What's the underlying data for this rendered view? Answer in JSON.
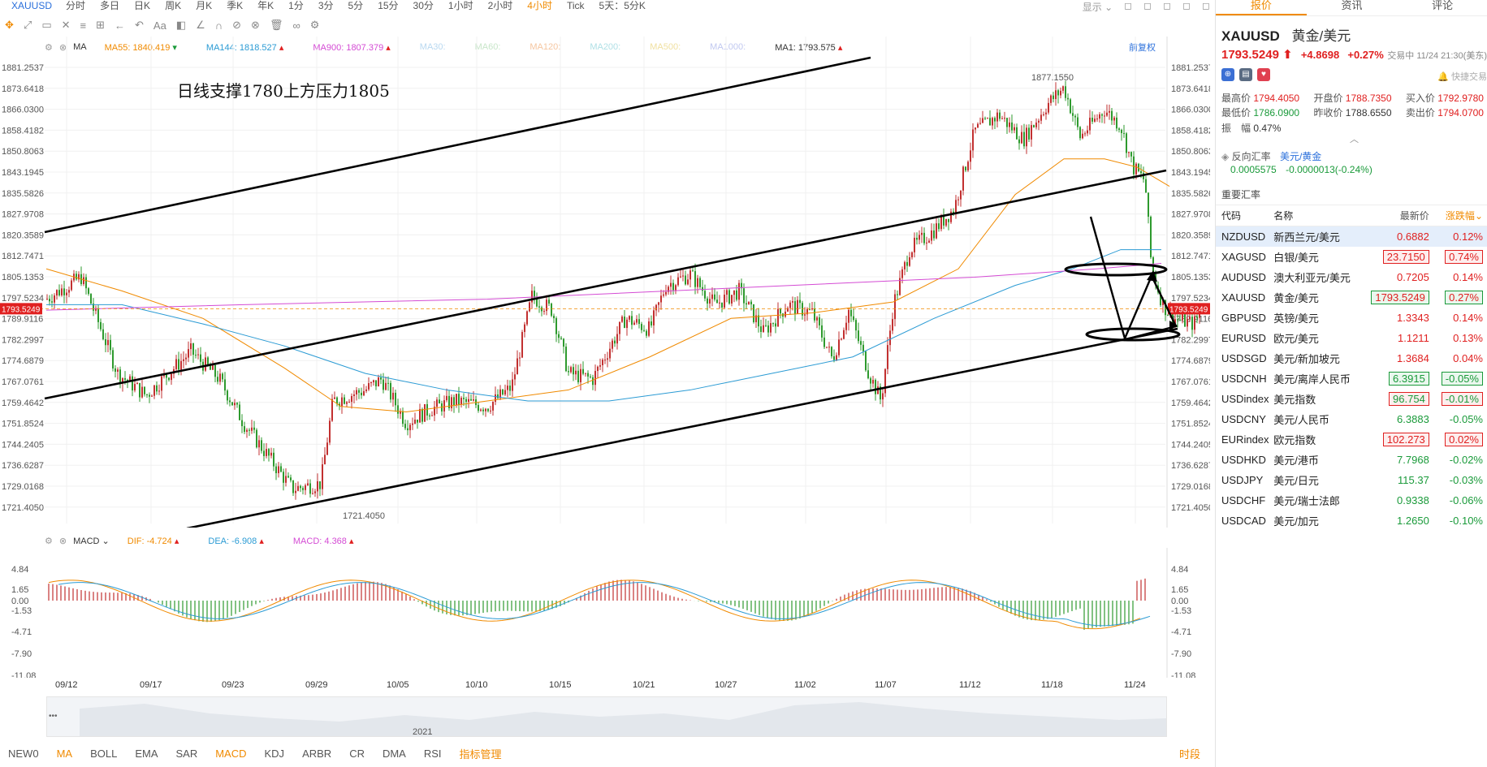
{
  "toolbar": {
    "symbol": "XAUUSD",
    "periods": [
      "分时",
      "多日",
      "日K",
      "周K",
      "月K",
      "季K",
      "年K",
      "1分",
      "3分",
      "5分",
      "15分",
      "30分",
      "1小时",
      "2小时",
      "4小时",
      "Tick",
      "5天：5分K"
    ],
    "active_period": "4小时",
    "display_label": "显示"
  },
  "tools": [
    "✥",
    "⤢",
    "▭",
    "✕",
    "≡",
    "⊞",
    "←",
    "↶",
    "Aa",
    "◧",
    "∠",
    "∩",
    "⊘",
    "⊗",
    "🗑",
    "∞",
    "⚙"
  ],
  "ma_header": {
    "name": "MA",
    "items": [
      {
        "label": "MA55: 1840.419",
        "color": "#f08a00",
        "arrow": "▾"
      },
      {
        "label": "MA144: 1818.527",
        "color": "#2b9bd4",
        "arrow": "▴"
      },
      {
        "label": "MA900: 1807.379",
        "color": "#d44bd4",
        "arrow": "▴"
      },
      {
        "label": "MA30:",
        "color": "#b8d8f0",
        "arrow": ""
      },
      {
        "label": "MA60:",
        "color": "#c8e6c9",
        "arrow": ""
      },
      {
        "label": "MA120:",
        "color": "#f5c6a0",
        "arrow": ""
      },
      {
        "label": "MA200:",
        "color": "#b0e0e6",
        "arrow": ""
      },
      {
        "label": "MA500:",
        "color": "#f0e0a0",
        "arrow": ""
      },
      {
        "label": "MA1000:",
        "color": "#c0c8f0",
        "arrow": ""
      },
      {
        "label": "MA1: 1793.575",
        "color": "#333333",
        "arrow": "▴"
      }
    ],
    "adjust_label": "前复权"
  },
  "annotation_text": "日线支撑1780上方压力1805",
  "price_axis": [
    "1881.2537",
    "1873.6418",
    "1866.0300",
    "1858.4182",
    "1850.8063",
    "1843.1945",
    "1835.5826",
    "1827.9708",
    "1820.3589",
    "1812.7471",
    "1805.1353",
    "1797.5234",
    "1789.9116",
    "1782.2997",
    "1774.6879",
    "1767.0761",
    "1759.4642",
    "1751.8524",
    "1744.2405",
    "1736.6287",
    "1729.0168",
    "1721.4050"
  ],
  "current_price_tag": "1793.5249",
  "high_label": "1877.1550",
  "low_label": "1721.4050",
  "macd_header": {
    "name": "MACD",
    "items": [
      {
        "label": "DIF: -4.724",
        "color": "#f08a00",
        "arrow": "▴"
      },
      {
        "label": "DEA: -6.908",
        "color": "#2b9bd4",
        "arrow": "▴"
      },
      {
        "label": "MACD: 4.368",
        "color": "#d44bd4",
        "arrow": "▴"
      }
    ]
  },
  "macd_axis": [
    "4.84",
    "1.65",
    "0.00",
    "-1.53",
    "-4.71",
    "-7.90",
    "-11.08"
  ],
  "dates": [
    "09/12",
    "09/17",
    "09/23",
    "09/29",
    "10/05",
    "10/10",
    "10/15",
    "10/21",
    "10/27",
    "11/02",
    "11/07",
    "11/12",
    "11/18",
    "11/24"
  ],
  "navigator_year": "2021",
  "indicators": [
    "NEW0",
    "MA",
    "BOLL",
    "EMA",
    "SAR",
    "MACD",
    "KDJ",
    "ARBR",
    "CR",
    "DMA",
    "RSI",
    "指标管理"
  ],
  "active_indicators": [
    "MA",
    "MACD",
    "指标管理"
  ],
  "indicator_end": "时段",
  "right_panel": {
    "tabs": [
      "报价",
      "资讯",
      "评论"
    ],
    "active_tab": "报价",
    "symbol": "XAUUSD",
    "name": "黄金/美元",
    "price": "1793.5249",
    "arrow": "⬆",
    "change": "+4.8698",
    "change_pct": "+0.27%",
    "time": "交易中 11/24 21:30(美东)",
    "quick_trade": "快捷交易",
    "stats": {
      "high_k": "最高价",
      "high_v": "1794.4050",
      "open_k": "开盘价",
      "open_v": "1788.7350",
      "bid_k": "买入价",
      "bid_v": "1792.9780",
      "low_k": "最低价",
      "low_v": "1786.0900",
      "prev_k": "昨收价",
      "prev_v": "1788.6550",
      "ask_k": "卖出价",
      "ask_v": "1794.0700",
      "amp_k": "振　幅",
      "amp_v": "0.47%"
    },
    "inverse_label": "反向汇率",
    "inverse_pair": "美元/黄金",
    "inverse_value": "0.0005575",
    "inverse_change": "-0.0000013(-0.24%)",
    "rates_title": "重要汇率",
    "columns": [
      "代码",
      "名称",
      "最新价",
      "涨跌幅"
    ],
    "rates": [
      {
        "code": "NZDUSD",
        "name": "新西兰元/美元",
        "last": "0.6882",
        "pct": "0.12%",
        "dir": "up",
        "box": ""
      },
      {
        "code": "XAGUSD",
        "name": "白银/美元",
        "last": "23.7150",
        "pct": "0.74%",
        "dir": "up",
        "box": "r"
      },
      {
        "code": "AUDUSD",
        "name": "澳大利亚元/美元",
        "last": "0.7205",
        "pct": "0.14%",
        "dir": "up",
        "box": ""
      },
      {
        "code": "XAUUSD",
        "name": "黄金/美元",
        "last": "1793.5249",
        "pct": "0.27%",
        "dir": "up",
        "box": "g"
      },
      {
        "code": "GBPUSD",
        "name": "英镑/美元",
        "last": "1.3343",
        "pct": "0.14%",
        "dir": "up",
        "box": ""
      },
      {
        "code": "EURUSD",
        "name": "欧元/美元",
        "last": "1.1211",
        "pct": "0.13%",
        "dir": "up",
        "box": ""
      },
      {
        "code": "USDSGD",
        "name": "美元/新加坡元",
        "last": "1.3684",
        "pct": "0.04%",
        "dir": "up",
        "box": ""
      },
      {
        "code": "USDCNH",
        "name": "美元/离岸人民币",
        "last": "6.3915",
        "pct": "-0.05%",
        "dir": "down",
        "box": "g"
      },
      {
        "code": "USDindex",
        "name": "美元指数",
        "last": "96.754",
        "pct": "-0.01%",
        "dir": "down",
        "box": "r"
      },
      {
        "code": "USDCNY",
        "name": "美元/人民币",
        "last": "6.3883",
        "pct": "-0.05%",
        "dir": "down",
        "box": ""
      },
      {
        "code": "EURindex",
        "name": "欧元指数",
        "last": "102.273",
        "pct": "0.02%",
        "dir": "up",
        "box": "r"
      },
      {
        "code": "USDHKD",
        "name": "美元/港币",
        "last": "7.7968",
        "pct": "-0.02%",
        "dir": "down",
        "box": ""
      },
      {
        "code": "USDJPY",
        "name": "美元/日元",
        "last": "115.37",
        "pct": "-0.03%",
        "dir": "down",
        "box": ""
      },
      {
        "code": "USDCHF",
        "name": "美元/瑞士法郎",
        "last": "0.9338",
        "pct": "-0.06%",
        "dir": "down",
        "box": ""
      },
      {
        "code": "USDCAD",
        "name": "美元/加元",
        "last": "1.2650",
        "pct": "-0.10%",
        "dir": "down",
        "box": ""
      }
    ]
  },
  "colors": {
    "up": "#c23030",
    "down": "#2e9a2e",
    "ma55": "#f08a00",
    "ma144": "#2b9bd4",
    "ma900": "#d44bd4",
    "accent": "#f08a00"
  }
}
